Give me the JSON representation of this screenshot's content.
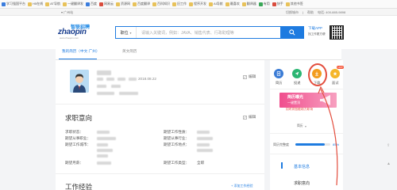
{
  "bookmarks": [
    {
      "label": "学习强国平台",
      "icon": "blue"
    },
    {
      "label": "H5在线",
      "icon": "folder"
    },
    {
      "label": "AT导航",
      "icon": "folder"
    },
    {
      "label": "一键翻译发",
      "icon": "folder"
    },
    {
      "label": "百度",
      "icon": "blue"
    },
    {
      "label": "网易云",
      "icon": "red"
    },
    {
      "label": "资源网",
      "icon": "folder"
    },
    {
      "label": "百度翻译",
      "icon": "folder"
    },
    {
      "label": "百科知识",
      "icon": "folder"
    },
    {
      "label": "旧工作",
      "icon": "folder"
    },
    {
      "label": "程序开发",
      "icon": "folder"
    },
    {
      "label": "AI导航",
      "icon": "folder"
    },
    {
      "label": "最喜欢",
      "icon": "folder"
    },
    {
      "label": "翻译器",
      "icon": "folder"
    },
    {
      "label": "有用",
      "icon": "green"
    },
    {
      "label": "快手",
      "icon": "red"
    },
    {
      "label": "其他书签",
      "icon": "folder"
    }
  ],
  "topstrip": {
    "location": "广州站",
    "right_items": [
      "切换城市",
      "|",
      "帮助",
      "电话: 400-885-9898"
    ]
  },
  "header": {
    "logo_text": "zhaopin",
    "logo_cn": "智联招聘",
    "logo_url": "www.zhaopin.com",
    "search_type": "职位",
    "search_placeholder": "请输入关键词，例如：JAVA、销售代表、行政助理等",
    "app_line1": "下载APP",
    "app_line2": "找工作更方便"
  },
  "tabs": [
    {
      "label": "我的简历（中文·广州）",
      "active": true
    },
    {
      "label": "英文简历",
      "active": false
    }
  ],
  "main": {
    "edit_label": "编辑",
    "date_text": "2018.08.22",
    "section_intent": "求职意向",
    "fields_left": [
      "求职状态：",
      "期望从事职业：",
      "期望工作城市：",
      "",
      "期望月薪："
    ],
    "fields_right": [
      "期望工作性质：",
      "期望从事行业：",
      "期望工作地点：",
      "",
      "期望工作类型："
    ],
    "value_fulltime": "全职",
    "section_work": "工作经验",
    "add_work": "+ 添加工作经验"
  },
  "side": {
    "tools": [
      {
        "label": "简历",
        "color": "#3a7bd5"
      },
      {
        "label": "投递",
        "color": "#2bb673"
      },
      {
        "label": "下载",
        "color": "#f39c1f"
      },
      {
        "label": "面试",
        "color": "#f5b62a"
      }
    ],
    "hot_badge": "HOT",
    "banner_text_1": "简历曝光",
    "banner_text_2": "一键置顶",
    "banner_caption": "用时尚智能助力职场",
    "small_link": "简历",
    "completeness_label": "简历完整度",
    "completeness_value": 0.85,
    "progress_value": "85%",
    "nav_items": [
      "基本信息",
      "求职意向",
      "工作经验"
    ]
  }
}
